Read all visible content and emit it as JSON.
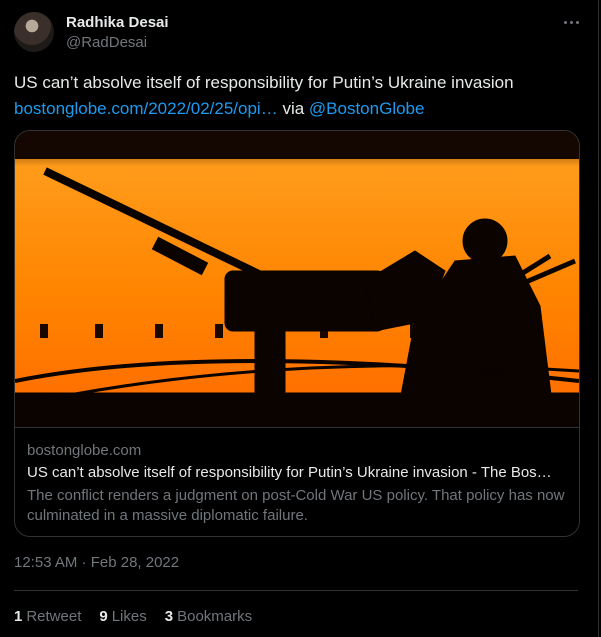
{
  "author": {
    "display_name": "Radhika Desai",
    "handle": "@RadDesai"
  },
  "tweet": {
    "text": "US can’t absolve itself of responsibility for Putin’s Ukraine invasion",
    "link_text": "bostonglobe.com/2022/02/25/opi…",
    "via_text": "via",
    "mention": "@BostonGlobe"
  },
  "card": {
    "domain": "bostonglobe.com",
    "title": "US can’t absolve itself of responsibility for Putin’s Ukraine invasion - The Bos…",
    "description": "The conflict renders a judgment on post-Cold War US policy. That policy has now culminated in a massive diplomatic failure.",
    "image_subject": "silhouette of soldier with mounted machine gun against orange sky"
  },
  "timestamp": "12:53 AM · Feb 28, 2022",
  "stats": {
    "retweets": {
      "count": "1",
      "label": "Retweet"
    },
    "likes": {
      "count": "9",
      "label": "Likes"
    },
    "bookmarks": {
      "count": "3",
      "label": "Bookmarks"
    }
  },
  "colors": {
    "background": "#000000",
    "text": "#e7e9ea",
    "muted": "#71767b",
    "link": "#1d9bf0",
    "border": "#2f3336",
    "image_orange": "#ff8a00"
  },
  "icons": [
    "more-icon"
  ]
}
